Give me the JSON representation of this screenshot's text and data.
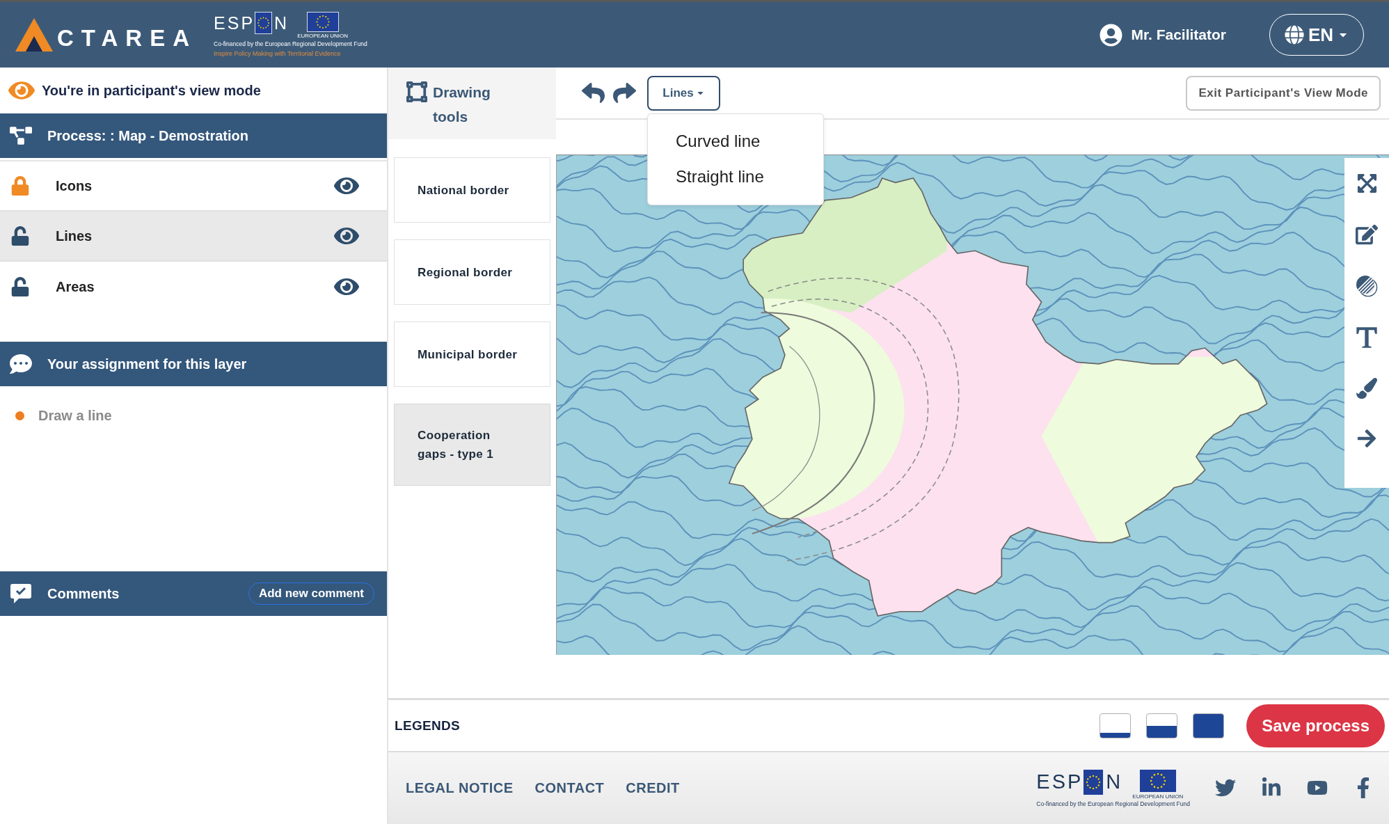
{
  "header": {
    "brand": "CTAREA",
    "partner_logo": {
      "letters_before_flag": "ESP",
      "letters_after_flag": "N",
      "flag_caption": "EUROPEAN UNION",
      "funding_note": "Co-financed by the European Regional Development Fund",
      "motto": "Inspire Policy Making with Territorial Evidence"
    },
    "user": "Mr. Facilitator",
    "language": "EN"
  },
  "sidebar": {
    "mode_notice": "You're in participant's view mode",
    "process": "Process: : Map - Demostration",
    "layers": [
      {
        "label": "Icons",
        "locked": true,
        "visible": true,
        "selected": false
      },
      {
        "label": "Lines",
        "locked": false,
        "visible": true,
        "selected": true
      },
      {
        "label": "Areas",
        "locked": false,
        "visible": true,
        "selected": false
      }
    ],
    "assignment": {
      "title": "Your assignment for this layer",
      "items": [
        "Draw a line"
      ]
    },
    "comments": {
      "title": "Comments",
      "add_button": "Add new comment"
    }
  },
  "drawing_tools": {
    "title": "Drawing tools",
    "tools": [
      {
        "label": "National border",
        "selected": false
      },
      {
        "label": "Regional border",
        "selected": false
      },
      {
        "label": "Municipal border",
        "selected": false
      },
      {
        "label": "Cooperation gaps - type 1",
        "selected": true
      }
    ]
  },
  "toolbar": {
    "layer_menu": {
      "label": "Lines",
      "expanded": true,
      "options": [
        "Curved line",
        "Straight line"
      ]
    },
    "exit_button": "Exit Participant's View Mode"
  },
  "legends": {
    "title": "LEGENDS",
    "styles": [
      {
        "kind": "line"
      },
      {
        "kind": "half"
      },
      {
        "kind": "full"
      }
    ],
    "save_button": "Save process"
  },
  "footer": {
    "links": [
      "LEGAL NOTICE",
      "CONTACT",
      "CREDIT"
    ],
    "partner_logo": {
      "letters_before_flag": "ESP",
      "letters_after_flag": "N",
      "flag_caption": "EUROPEAN UNION",
      "funding_note": "Co-financed by the European Regional Development Fund"
    },
    "social": [
      {
        "kind": "twitter"
      },
      {
        "kind": "linkedin"
      },
      {
        "kind": "youtube"
      },
      {
        "kind": "facebook"
      }
    ]
  }
}
